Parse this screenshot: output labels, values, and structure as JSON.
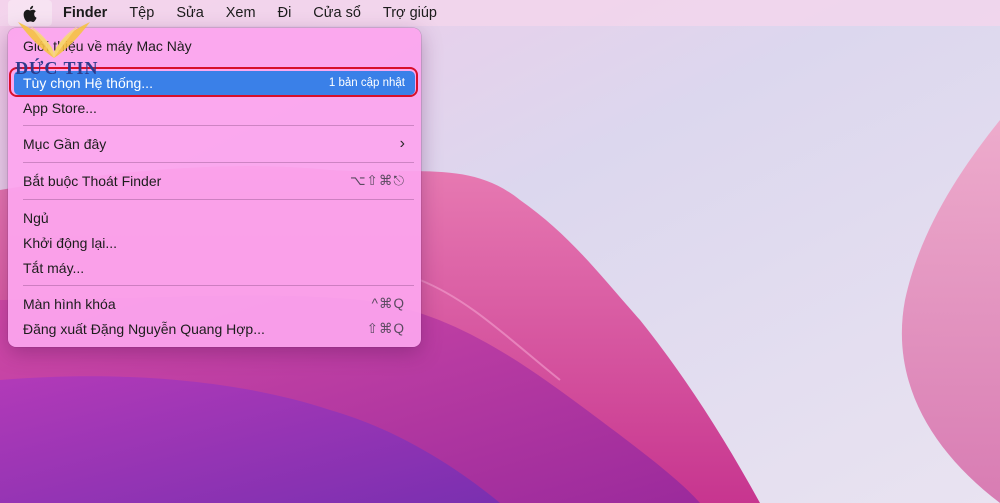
{
  "menubar": {
    "apple_icon": "apple-logo-icon",
    "items": [
      "Finder",
      "Tệp",
      "Sửa",
      "Xem",
      "Đi",
      "Cửa sổ",
      "Trợ giúp"
    ]
  },
  "apple_menu": {
    "items": {
      "about": "Giới thiệu về máy Mac Này",
      "system_prefs": "Tùy chọn Hệ thống...",
      "system_prefs_badge": "1 bản cập nhật",
      "app_store": "App Store...",
      "recent": "Mục Gần đây",
      "force_quit": "Bắt buộc Thoát Finder",
      "force_quit_shortcut": "⌥⇧⌘⎋",
      "sleep": "Ngủ",
      "restart": "Khởi động lại...",
      "shutdown": "Tắt máy...",
      "lock": "Màn hình khóa",
      "lock_shortcut": "^⌘Q",
      "logout": "Đăng xuất Đặng Nguyễn Quang Hợp...",
      "logout_shortcut": "⇧⌘Q"
    }
  },
  "watermark": {
    "text": "ĐỨC TIN"
  },
  "colors": {
    "highlight": "#3a80e8",
    "annotation_box": "#d8102a",
    "menu_bg": "#fca5ee"
  }
}
